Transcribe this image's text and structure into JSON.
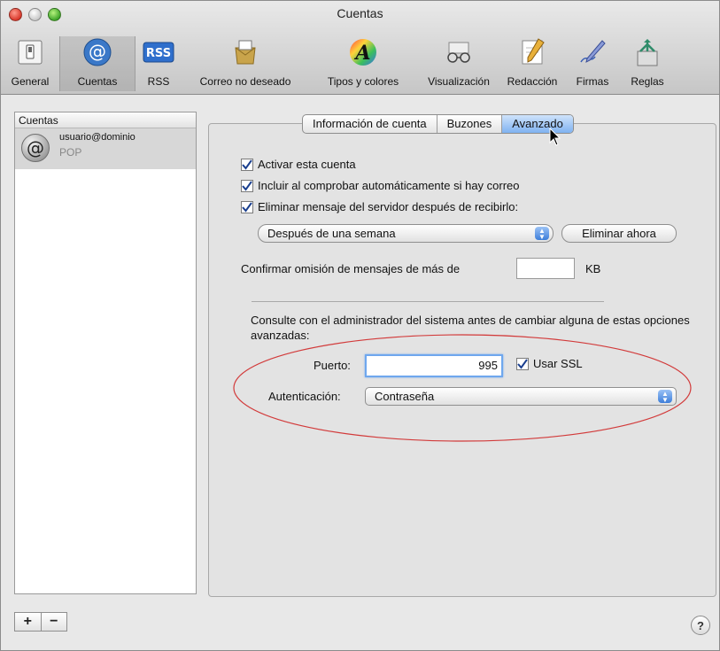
{
  "window": {
    "title": "Cuentas"
  },
  "toolbar": {
    "items": [
      {
        "label": "General",
        "icon": "general-switch-icon"
      },
      {
        "label": "Cuentas",
        "icon": "at-sign-icon",
        "selected": true
      },
      {
        "label": "RSS",
        "icon": "rss-icon"
      },
      {
        "label": "Correo no deseado",
        "icon": "junk-mail-icon"
      },
      {
        "label": "Tipos y colores",
        "icon": "fonts-colors-icon"
      },
      {
        "label": "Visualización",
        "icon": "viewing-glasses-icon"
      },
      {
        "label": "Redacción",
        "icon": "composing-pencil-icon"
      },
      {
        "label": "Firmas",
        "icon": "signature-pen-icon"
      },
      {
        "label": "Reglas",
        "icon": "rules-icon"
      }
    ],
    "rss_badge": "RSS",
    "at_glyph": "@",
    "fonts_glyph": "A"
  },
  "sidebar": {
    "header": "Cuentas",
    "accounts": [
      {
        "email": "usuario@dominio",
        "type": "POP"
      }
    ],
    "add_label": "+",
    "remove_label": "−"
  },
  "tabs": [
    {
      "label": "Información de cuenta"
    },
    {
      "label": "Buzones"
    },
    {
      "label": "Avanzado",
      "active": true
    }
  ],
  "options": {
    "enable_account": {
      "label": "Activar esta cuenta",
      "checked": true
    },
    "include_auto_check": {
      "label": "Incluir al comprobar automáticamente si hay correo",
      "checked": true
    },
    "remove_from_server": {
      "label": "Eliminar mensaje del servidor después de recibirlo:",
      "checked": true
    },
    "remove_after": {
      "selected": "Después de una semana"
    },
    "remove_now_button": "Eliminar ahora",
    "confirm_skip": {
      "label": "Confirmar omisión de mensajes de más de",
      "value": "",
      "unit": "KB"
    }
  },
  "advanced": {
    "note": "Consulte con el administrador del sistema antes de cambiar alguna de estas opciones avanzadas:",
    "port": {
      "label": "Puerto:",
      "value": "995"
    },
    "ssl": {
      "label": "Usar SSL",
      "checked": true
    },
    "auth": {
      "label": "Autenticación:",
      "selected": "Contraseña"
    }
  },
  "help_label": "?",
  "colors": {
    "accent": "#7fb2f1",
    "annotation": "#d23a3a"
  }
}
